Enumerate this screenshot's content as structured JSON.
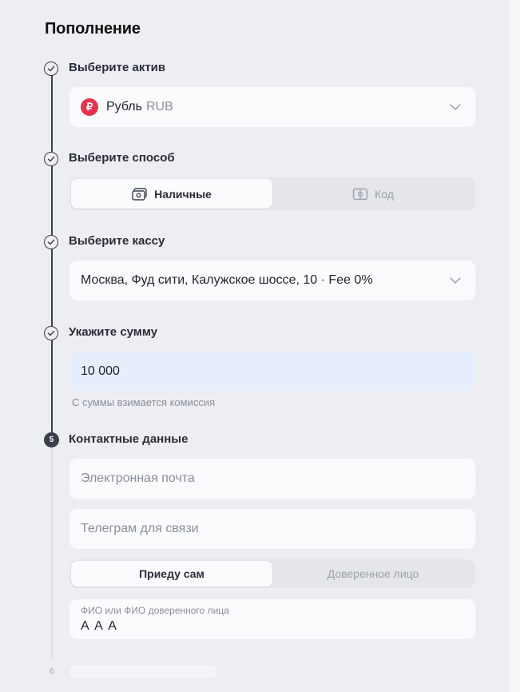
{
  "page": {
    "title": "Пополнение"
  },
  "steps": {
    "asset": {
      "title": "Выберите актив",
      "icon": "ruble-icon",
      "icon_glyph": "₽",
      "name": "Рубль",
      "code": "RUB"
    },
    "method": {
      "title": "Выберите способ",
      "options": [
        {
          "label": "Наличные",
          "icon": "cash-icon",
          "active": true
        },
        {
          "label": "Код",
          "icon": "code-card-icon",
          "active": false
        }
      ]
    },
    "cashdesk": {
      "title": "Выберите кассу",
      "value": "Москва, Фуд сити, Калужское шоссе, 10 · Fee 0%"
    },
    "amount": {
      "title": "Укажите сумму",
      "value": "10 000",
      "hint": "С суммы взимается комиссия"
    },
    "contacts": {
      "number": "5",
      "title": "Контактные данные",
      "email_placeholder": "Электронная почта",
      "telegram_placeholder": "Телеграм для связи",
      "who": [
        {
          "label": "Приеду сам",
          "active": true
        },
        {
          "label": "Доверенное лицо",
          "active": false
        }
      ],
      "fio_label": "ФИО или ФИО доверенного лица",
      "fio_value": "А А А"
    },
    "next": {
      "number": "6"
    }
  },
  "colors": {
    "accent": "#3b3f4e",
    "ruble": "#e5334f",
    "amount_bg": "#e7eefb",
    "background": "#eceef1"
  }
}
